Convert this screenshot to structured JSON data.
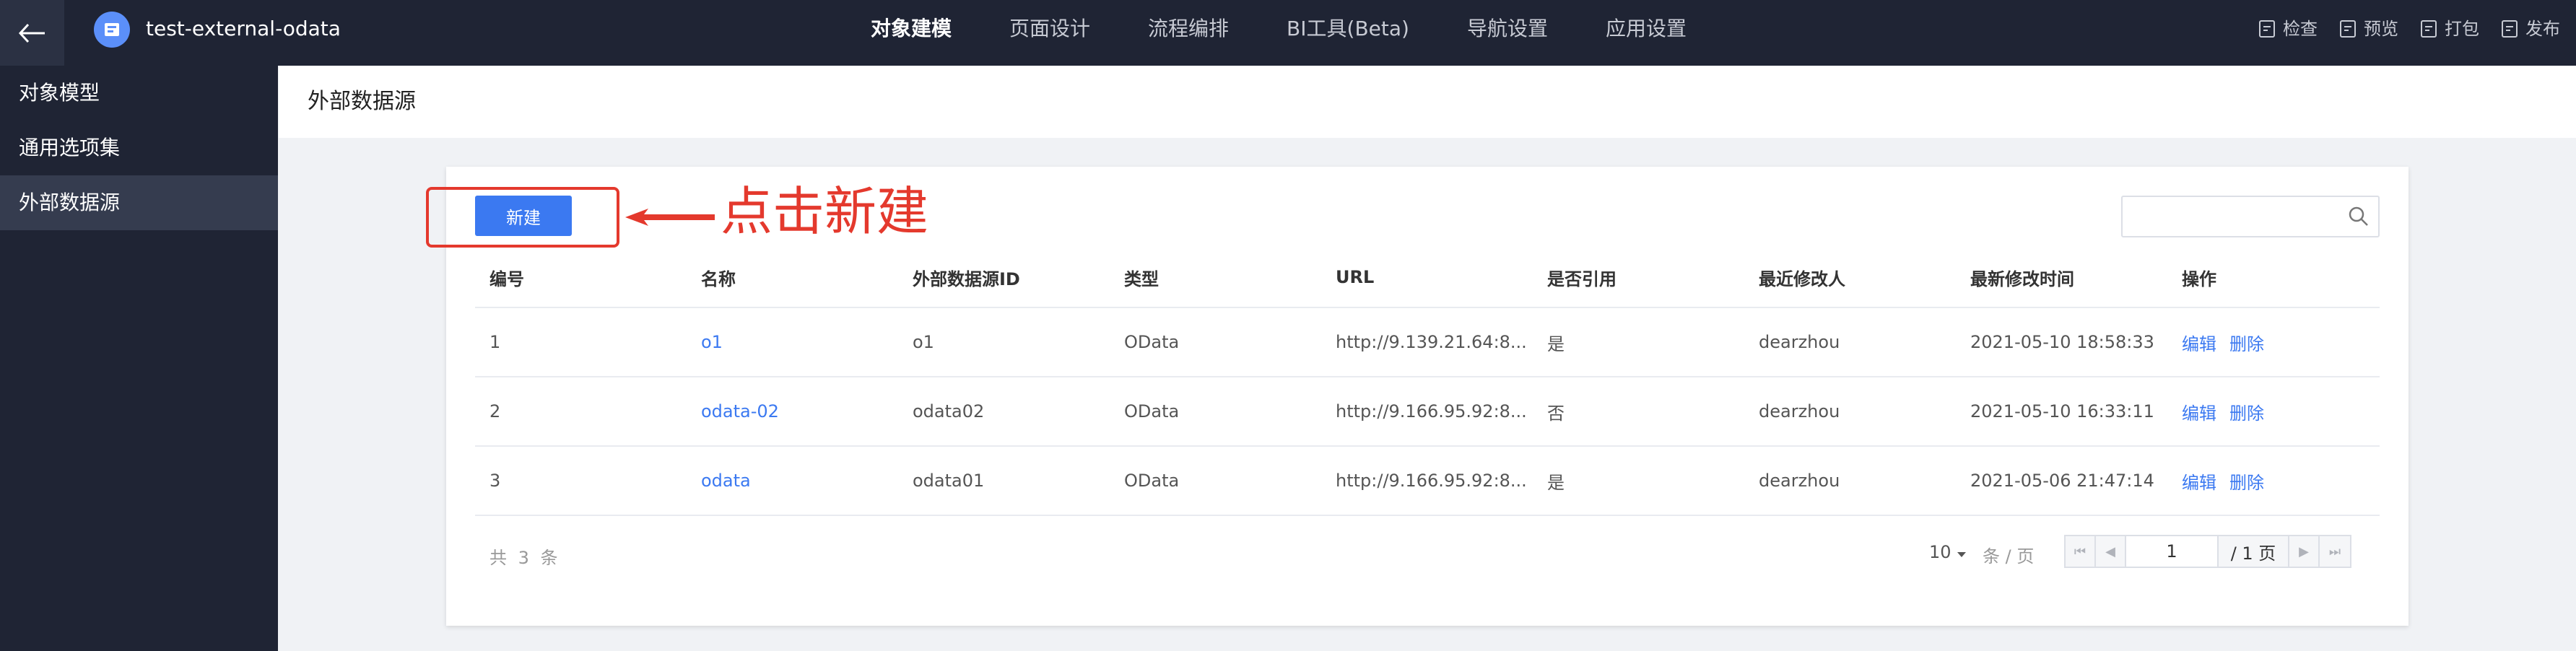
{
  "topbar": {
    "app_name": "test-external-odata",
    "nav": [
      "对象建模",
      "页面设计",
      "流程编排",
      "BI工具(Beta)",
      "导航设置",
      "应用设置"
    ],
    "active_nav": "对象建模",
    "tools": [
      "检查",
      "预览",
      "打包",
      "发布"
    ]
  },
  "sidebar": {
    "items": [
      "对象模型",
      "通用选项集",
      "外部数据源"
    ],
    "active": "外部数据源"
  },
  "page": {
    "title": "外部数据源"
  },
  "toolbar": {
    "new_label": "新建",
    "annotation": "点击新建",
    "search_placeholder": ""
  },
  "table": {
    "columns": [
      "编号",
      "名称",
      "外部数据源ID",
      "类型",
      "URL",
      "是否引用",
      "最近修改人",
      "最新修改时间",
      "操作"
    ],
    "rows": [
      {
        "no": "1",
        "name": "o1",
        "id": "o1",
        "type": "OData",
        "url": "http://9.139.21.64:8...",
        "referenced": "是",
        "modifier": "dearzhou",
        "modified": "2021-05-10 18:58:33",
        "edit": "编辑",
        "delete": "删除"
      },
      {
        "no": "2",
        "name": "odata-02",
        "id": "odata02",
        "type": "OData",
        "url": "http://9.166.95.92:8...",
        "referenced": "否",
        "modifier": "dearzhou",
        "modified": "2021-05-10 16:33:11",
        "edit": "编辑",
        "delete": "删除"
      },
      {
        "no": "3",
        "name": "odata",
        "id": "odata01",
        "type": "OData",
        "url": "http://9.166.95.92:8...",
        "referenced": "是",
        "modifier": "dearzhou",
        "modified": "2021-05-06 21:47:14",
        "edit": "编辑",
        "delete": "删除"
      }
    ]
  },
  "pagination": {
    "total_text": "共 3 条",
    "page_size": "10",
    "per_page_label": "条 / 页",
    "current_page": "1",
    "total_pages": "/ 1 页"
  },
  "colors": {
    "topbar": "#1f2434",
    "accent": "#3b79f1",
    "annotation": "#e4392d"
  }
}
